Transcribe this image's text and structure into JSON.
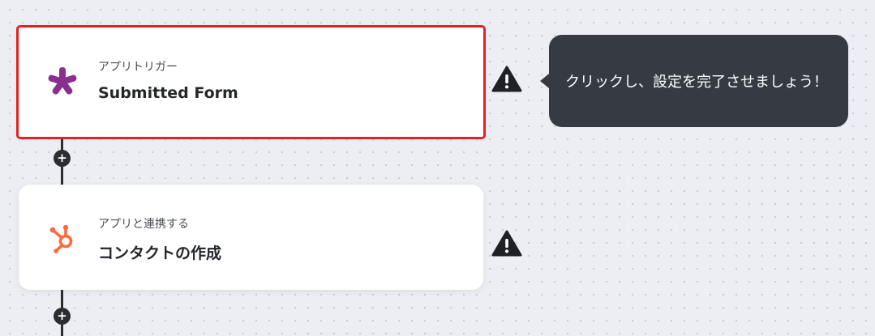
{
  "flow": {
    "steps": [
      {
        "subtitle": "アプリトリガー",
        "title": "Submitted Form",
        "icon": "asterisk-icon",
        "icon_color": "#8b2f8f",
        "selected": true,
        "warning": "warning-icon"
      },
      {
        "subtitle": "アプリと連携する",
        "title": "コンタクトの作成",
        "icon": "hubspot-icon",
        "icon_color": "#ff6a3d",
        "selected": false,
        "warning": "warning-icon"
      }
    ],
    "add_step_symbol": "+"
  },
  "tooltip": {
    "text": "クリックし、設定を完了させましょう！"
  },
  "colors": {
    "selection_border": "#e02424",
    "tooltip_bg": "#363a42",
    "canvas_bg": "#eceef3"
  }
}
